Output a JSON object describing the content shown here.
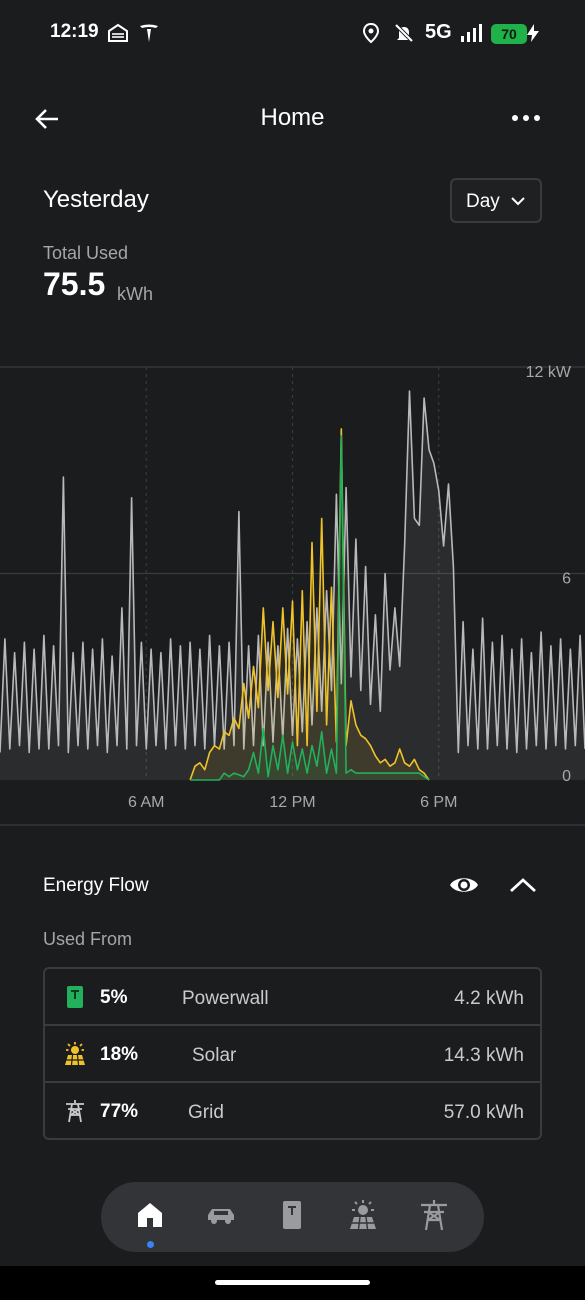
{
  "status_bar": {
    "time": "12:19",
    "network": "5G",
    "battery": "70"
  },
  "header": {
    "title": "Home"
  },
  "period": {
    "title": "Yesterday",
    "selector_value": "Day"
  },
  "total": {
    "label": "Total Used",
    "value": "75.5",
    "unit": "kWh"
  },
  "chart_data": {
    "type": "line",
    "x_tick_labels": [
      "6 AM",
      "12 PM",
      "6 PM"
    ],
    "y_tick_labels": [
      "12 kW",
      "6",
      "0"
    ],
    "ylim": [
      0,
      12
    ],
    "xlim_hours": [
      0,
      24
    ],
    "grid": true,
    "colors": {
      "home": "#b9b9bb",
      "solar": "#f0c22a",
      "powerwall": "#22b05c"
    },
    "series": [
      {
        "key": "home",
        "x": [
          0.0,
          0.2,
          0.4,
          0.6,
          0.8,
          1.0,
          1.2,
          1.4,
          1.6,
          1.8,
          2.0,
          2.2,
          2.4,
          2.6,
          2.8,
          3.0,
          3.2,
          3.4,
          3.6,
          3.8,
          4.0,
          4.2,
          4.4,
          4.6,
          4.8,
          5.0,
          5.2,
          5.4,
          5.6,
          5.8,
          6.0,
          6.2,
          6.4,
          6.6,
          6.8,
          7.0,
          7.2,
          7.4,
          7.6,
          7.8,
          8.0,
          8.2,
          8.4,
          8.6,
          8.8,
          9.0,
          9.2,
          9.4,
          9.6,
          9.8,
          10.0,
          10.2,
          10.4,
          10.6,
          10.8,
          11.0,
          11.2,
          11.4,
          11.6,
          11.8,
          12.0,
          12.2,
          12.4,
          12.6,
          12.8,
          13.0,
          13.2,
          13.4,
          13.6,
          13.8,
          14.0,
          14.2,
          14.4,
          14.6,
          14.8,
          15.0,
          15.2,
          15.4,
          15.6,
          15.8,
          16.0,
          16.2,
          16.4,
          16.6,
          16.8,
          17.0,
          17.2,
          17.4,
          17.6,
          17.8,
          18.0,
          18.2,
          18.4,
          18.6,
          18.8,
          19.0,
          19.2,
          19.4,
          19.6,
          19.8,
          20.0,
          20.2,
          20.4,
          20.6,
          20.8,
          21.0,
          21.2,
          21.4,
          21.6,
          21.8,
          22.0,
          22.2,
          22.4,
          22.6,
          22.8,
          23.0,
          23.2,
          23.4,
          23.6,
          23.8,
          24.0
        ],
        "values": [
          0.8,
          4.1,
          0.9,
          3.7,
          1.0,
          4.0,
          0.8,
          3.8,
          0.9,
          4.2,
          0.9,
          3.9,
          1.0,
          8.8,
          0.8,
          3.7,
          1.0,
          4.0,
          0.9,
          3.8,
          1.0,
          4.1,
          0.8,
          3.6,
          1.0,
          5.0,
          0.9,
          8.2,
          1.0,
          4.0,
          0.9,
          3.8,
          1.0,
          3.7,
          0.9,
          4.1,
          1.0,
          3.9,
          0.9,
          4.0,
          1.0,
          3.8,
          0.9,
          4.2,
          1.0,
          3.9,
          0.9,
          4.0,
          1.0,
          7.8,
          0.9,
          3.9,
          1.0,
          4.2,
          1.0,
          4.0,
          1.1,
          3.9,
          1.2,
          4.4,
          1.3,
          4.1,
          1.4,
          4.6,
          1.6,
          5.0,
          2.0,
          5.5,
          2.6,
          8.3,
          2.8,
          8.5,
          3.0,
          7.0,
          2.6,
          6.2,
          2.2,
          4.8,
          2.0,
          6.0,
          3.2,
          5.0,
          3.3,
          6.8,
          11.3,
          7.6,
          7.4,
          11.1,
          9.6,
          9.2,
          8.4,
          6.8,
          8.6,
          6.2,
          0.8,
          4.6,
          1.0,
          3.8,
          0.9,
          4.7,
          0.9,
          4.0,
          1.0,
          4.2,
          0.9,
          3.8,
          0.8,
          4.1,
          0.9,
          3.7,
          1.0,
          4.3,
          0.9,
          3.9,
          1.0,
          4.1,
          0.9,
          3.8,
          1.0,
          4.2,
          0.9
        ]
      },
      {
        "key": "solar",
        "x": [
          7.8,
          8.0,
          8.2,
          8.4,
          8.6,
          8.8,
          9.0,
          9.2,
          9.4,
          9.6,
          9.8,
          10.0,
          10.2,
          10.4,
          10.6,
          10.8,
          11.0,
          11.2,
          11.4,
          11.6,
          11.8,
          12.0,
          12.2,
          12.4,
          12.6,
          12.8,
          13.0,
          13.2,
          13.4,
          13.6,
          13.8,
          14.0,
          14.2,
          14.4,
          14.6,
          14.8,
          15.0,
          15.2,
          15.4,
          15.6,
          15.8,
          16.0,
          16.2,
          16.4,
          16.6,
          16.8,
          17.0,
          17.2,
          17.4,
          17.6
        ],
        "values": [
          0,
          0.4,
          0.5,
          0.3,
          0.8,
          1.0,
          0.9,
          1.4,
          1.3,
          1.8,
          1.5,
          2.8,
          1.8,
          3.3,
          2.1,
          5.0,
          2.6,
          4.6,
          2.4,
          5.0,
          2.5,
          5.2,
          1.0,
          5.5,
          1.0,
          6.9,
          2.0,
          7.6,
          1.6,
          5.6,
          1.1,
          10.2,
          1.0,
          2.3,
          1.6,
          1.3,
          1.2,
          1.0,
          0.7,
          0.5,
          0.6,
          0.4,
          0.5,
          0.9,
          0.5,
          0.4,
          0.6,
          0.3,
          0.2,
          0
        ]
      },
      {
        "key": "powerwall",
        "x": [
          7.8,
          9.0,
          9.2,
          9.4,
          9.6,
          10.0,
          10.2,
          10.4,
          10.6,
          10.8,
          11.0,
          11.2,
          11.4,
          11.6,
          11.8,
          12.0,
          12.2,
          12.4,
          12.6,
          12.8,
          13.0,
          13.2,
          13.4,
          13.6,
          13.8,
          14.0,
          14.2,
          14.4,
          14.6,
          14.8,
          15.0,
          15.2,
          15.4,
          15.6,
          15.8,
          16.0,
          16.2,
          16.4,
          16.6,
          16.8,
          17.0,
          17.2,
          17.4,
          17.6
        ],
        "values": [
          0,
          0,
          0.2,
          0.1,
          0.2,
          0.1,
          0.3,
          0.8,
          0.2,
          1.5,
          0.1,
          1.0,
          0.3,
          1.3,
          0.2,
          1.1,
          0.3,
          0.9,
          0.2,
          1.0,
          0.4,
          1.4,
          0.2,
          0.9,
          0.2,
          10.0,
          0.2,
          0.3,
          0.2,
          0.2,
          0.2,
          0.2,
          0.2,
          0.2,
          0.2,
          0.2,
          0.2,
          0.2,
          0.2,
          0.2,
          0.2,
          0.2,
          0.1,
          0
        ]
      }
    ]
  },
  "energy_flow": {
    "title": "Energy Flow",
    "subtitle": "Used From",
    "sources": [
      {
        "icon": "powerwall-icon",
        "pct": "5%",
        "name": "Powerwall",
        "value": "4.2 kWh",
        "color": "#22b05c"
      },
      {
        "icon": "solar-icon",
        "pct": "18%",
        "name": "Solar",
        "value": "14.3 kWh",
        "color": "#f0c22a"
      },
      {
        "icon": "grid-icon",
        "pct": "77%",
        "name": "Grid",
        "value": "57.0 kWh",
        "color": "#b9b9bb"
      }
    ]
  },
  "bottom_nav": {
    "items": [
      "home-icon",
      "car-icon",
      "powerwall-icon",
      "solar-icon",
      "grid-icon"
    ],
    "active": "home-icon"
  }
}
